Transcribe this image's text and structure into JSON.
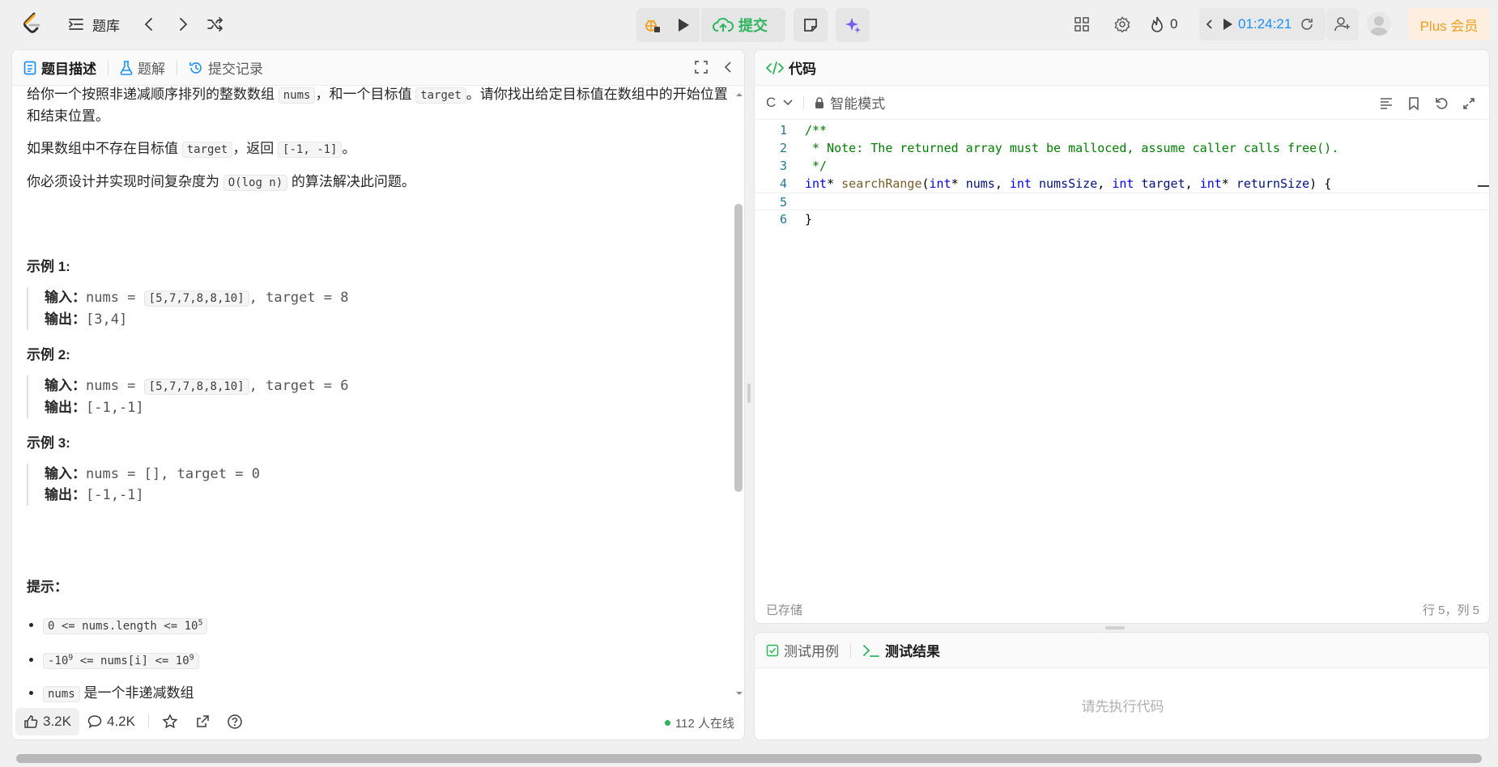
{
  "colors": {
    "accent_blue": "#1a90ff",
    "accent_green": "#2db55d",
    "plus_orange": "#f0a020"
  },
  "topbar": {
    "problem_list_label": "题库",
    "submit_label": "提交",
    "streak_count": "0",
    "timer": "01:24:21",
    "plus_label": "Plus 会员"
  },
  "left_tabs": [
    {
      "label": "题目描述"
    },
    {
      "label": "题解"
    },
    {
      "label": "提交记录"
    }
  ],
  "description": {
    "p1_a": "给你一个按照非递减顺序排列的整数数组 ",
    "p1_code1": "nums",
    "p1_b": "，和一个目标值 ",
    "p1_code2": "target",
    "p1_c": "。请你找出给定目标值在数组中的开始位置和结束位置。",
    "p2_a": "如果数组中不存在目标值 ",
    "p2_code1": "target",
    "p2_b": "，返回 ",
    "p2_code2": "[-1, -1]",
    "p2_c": "。",
    "p3_a": "你必须设计并实现时间复杂度为 ",
    "p3_code": "O(log n)",
    "p3_b": " 的算法解决此问题。"
  },
  "examples": [
    {
      "title": "示例 1:",
      "input_label": "输入：",
      "input_pre": "nums = ",
      "input_code": "[5,7,7,8,8,10]",
      "input_post": ", target = 8",
      "output_label": "输出：",
      "output": "[3,4]"
    },
    {
      "title": "示例 2:",
      "input_label": "输入：",
      "input_pre": "nums = ",
      "input_code": "[5,7,7,8,8,10]",
      "input_post": ", target = 6",
      "output_label": "输出：",
      "output": "[-1,-1]"
    },
    {
      "title": "示例 3:",
      "input_label": "输入：",
      "input_pre": "nums = [], target = 0",
      "input_code": "",
      "input_post": "",
      "output_label": "输出：",
      "output": "[-1,-1]"
    }
  ],
  "hints": {
    "title": "提示：",
    "h1_a": "0 <= nums.length <= 10",
    "h1_sup": "5",
    "h2_a": "-10",
    "h2_sup1": "9",
    "h2_b": " <= nums[i] <= 10",
    "h2_sup2": "9",
    "h3_code": "nums",
    "h3_text": " 是一个非递减数组"
  },
  "left_footer": {
    "likes": "3.2K",
    "comments": "4.2K",
    "online": "112 人在线"
  },
  "code_panel": {
    "title": "代码",
    "language": "C",
    "mode": "智能模式",
    "saved": "已存储",
    "position": "行 5，列 5"
  },
  "code_lines": [
    {
      "no": "1",
      "text": "/**"
    },
    {
      "no": "2",
      "text": " * Note: The returned array must be malloced, assume caller calls free()."
    },
    {
      "no": "3",
      "text": " */"
    },
    {
      "no": "4",
      "text": "int* searchRange(int* nums, int numsSize, int target, int* returnSize) {"
    },
    {
      "no": "5",
      "text": "    "
    },
    {
      "no": "6",
      "text": "}"
    }
  ],
  "test_panel": {
    "tab_cases": "测试用例",
    "tab_results": "测试结果",
    "placeholder": "请先执行代码"
  }
}
